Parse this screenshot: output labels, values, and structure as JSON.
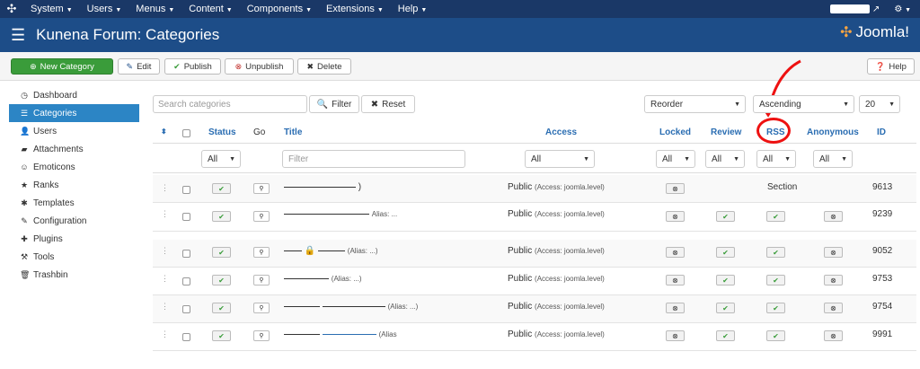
{
  "topnav": {
    "menus": [
      "System",
      "Users",
      "Menus",
      "Content",
      "Components",
      "Extensions",
      "Help"
    ]
  },
  "titlebar": {
    "title": "Kunena Forum: Categories",
    "brand": "Joomla!"
  },
  "toolbar": {
    "new": "New Category",
    "edit": "Edit",
    "publish": "Publish",
    "unpublish": "Unpublish",
    "delete": "Delete",
    "help": "Help"
  },
  "sidebar": {
    "items": [
      "Dashboard",
      "Categories",
      "Users",
      "Attachments",
      "Emoticons",
      "Ranks",
      "Templates",
      "Configuration",
      "Plugins",
      "Tools",
      "Trashbin"
    ]
  },
  "filters": {
    "search_placeholder": "Search categories",
    "filter_btn": "Filter",
    "reset_btn": "Reset",
    "order": "Reorder",
    "direction": "Ascending",
    "limit": "20",
    "title_placeholder": "Filter",
    "all": "All"
  },
  "columns": {
    "status": "Status",
    "go": "Go",
    "title": "Title",
    "access": "Access",
    "locked": "Locked",
    "review": "Review",
    "rss": "RSS",
    "anonymous": "Anonymous",
    "id": "ID"
  },
  "rows": [
    {
      "title_suffix": ")",
      "access": "Public",
      "access_note": "(Access: joomla.level)",
      "rss_text": "Section",
      "id": "9613"
    },
    {
      "title_suffix": "Alias: ...",
      "access": "Public",
      "access_note": "(Access: joomla.level)",
      "id": "9239"
    },
    {
      "title_suffix": "(Alias: ...)",
      "access": "Public",
      "access_note": "(Access: joomla.level)",
      "id": "9052"
    },
    {
      "title_suffix": "(Alias: ...)",
      "access": "Public",
      "access_note": "(Access: joomla.level)",
      "id": "9753"
    },
    {
      "title_suffix": "(Alias: ...)",
      "access": "Public",
      "access_note": "(Access: joomla.level)",
      "id": "9754"
    },
    {
      "title_suffix": "(Alias",
      "access": "Public",
      "access_note": "(Access: joomla.level)",
      "id": "9991"
    }
  ],
  "colors": {
    "nav": "#1a3867",
    "titlebar": "#1d4d88",
    "active": "#2c85c5",
    "annotation": "#e11111"
  }
}
